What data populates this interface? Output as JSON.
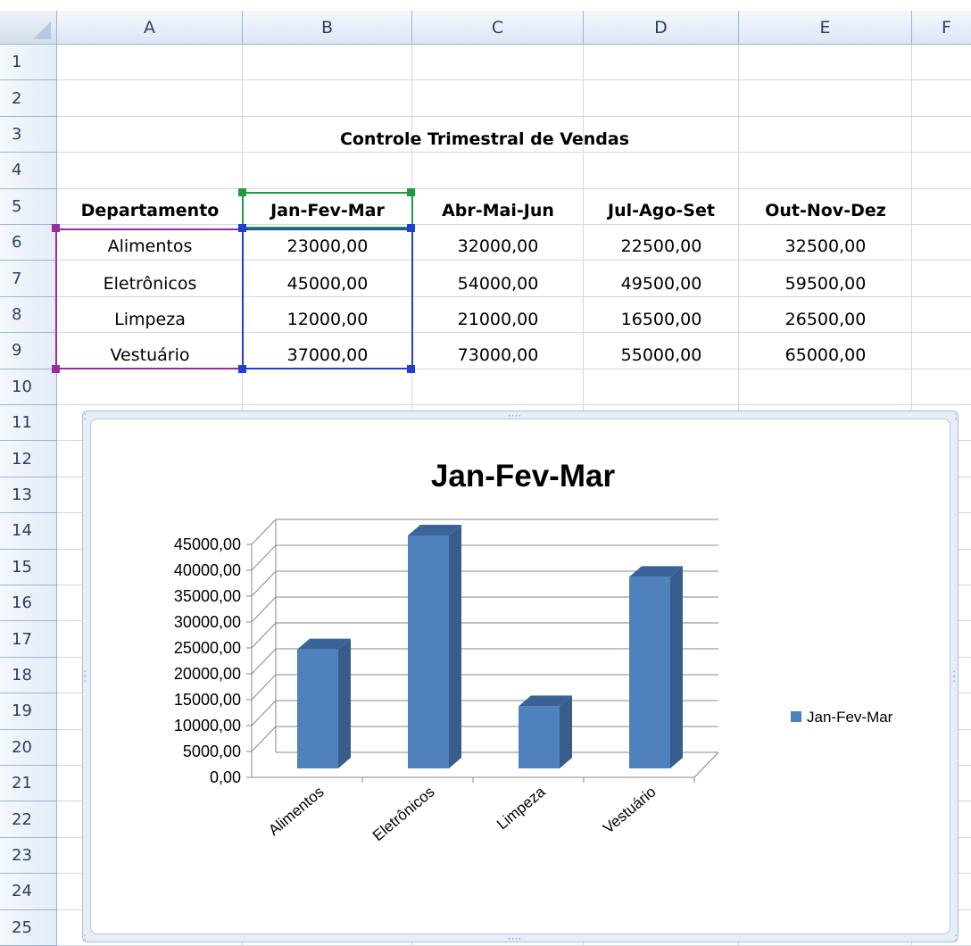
{
  "sheet": {
    "columns": [
      "A",
      "B",
      "C",
      "D",
      "E",
      "F"
    ],
    "rows": [
      "1",
      "2",
      "3",
      "4",
      "5",
      "6",
      "7",
      "8",
      "9",
      "10",
      "11",
      "12",
      "13",
      "14",
      "15",
      "16",
      "17",
      "18",
      "19",
      "20",
      "21",
      "22",
      "23",
      "24",
      "25"
    ],
    "title": "Controle Trimestral de Vendas",
    "headers": [
      "Departamento",
      "Jan-Fev-Mar",
      "Abr-Mai-Jun",
      "Jul-Ago-Set",
      "Out-Nov-Dez"
    ],
    "data": [
      [
        "Alimentos",
        "23000,00",
        "32000,00",
        "22500,00",
        "32500,00"
      ],
      [
        "Eletrônicos",
        "45000,00",
        "54000,00",
        "49500,00",
        "59500,00"
      ],
      [
        "Limpeza",
        "12000,00",
        "21000,00",
        "16500,00",
        "26500,00"
      ],
      [
        "Vestuário",
        "37000,00",
        "73000,00",
        "55000,00",
        "65000,00"
      ]
    ]
  },
  "chart_data": {
    "type": "bar",
    "title": "Jan-Fev-Mar",
    "categories": [
      "Alimentos",
      "Eletrônicos",
      "Limpeza",
      "Vestuário"
    ],
    "series": [
      {
        "name": "Jan-Fev-Mar",
        "values": [
          23000,
          45000,
          12000,
          37000
        ]
      }
    ],
    "y_ticks": [
      "0,00",
      "5000,00",
      "10000,00",
      "15000,00",
      "20000,00",
      "25000,00",
      "30000,00",
      "35000,00",
      "40000,00",
      "45000,00"
    ],
    "ylim": [
      0,
      45000
    ],
    "grid": true,
    "legend": "right",
    "style": "3d-column"
  },
  "colors": {
    "bar_front": "#4f81bd",
    "bar_side": "#385d8a",
    "bar_top": "#3a6497",
    "selection_green": "#1f9a3f",
    "selection_blue": "#1f3fd6",
    "selection_purple": "#9b2ca0"
  }
}
